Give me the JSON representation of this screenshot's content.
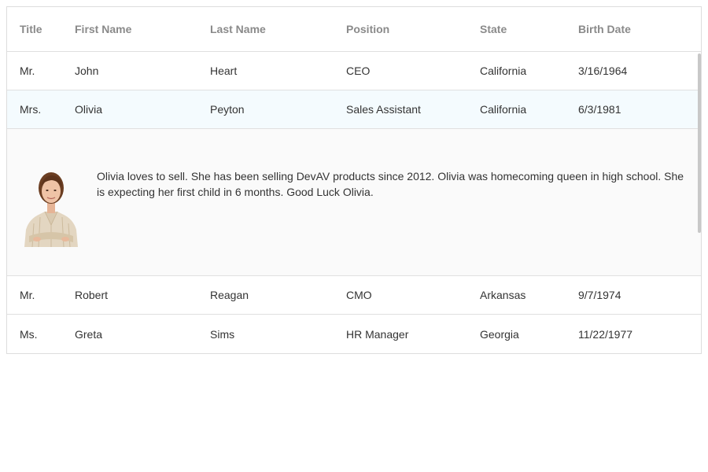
{
  "columns": [
    "Title",
    "First Name",
    "Last Name",
    "Position",
    "State",
    "Birth Date"
  ],
  "rows": [
    {
      "title": "Mr.",
      "first": "John",
      "last": "Heart",
      "position": "CEO",
      "state": "California",
      "birth": "3/16/1964"
    },
    {
      "title": "Mrs.",
      "first": "Olivia",
      "last": "Peyton",
      "position": "Sales Assistant",
      "state": "California",
      "birth": "6/3/1981"
    },
    {
      "title": "Mr.",
      "first": "Robert",
      "last": "Reagan",
      "position": "CMO",
      "state": "Arkansas",
      "birth": "9/7/1974"
    },
    {
      "title": "Ms.",
      "first": "Greta",
      "last": "Sims",
      "position": "HR Manager",
      "state": "Georgia",
      "birth": "11/22/1977"
    }
  ],
  "detail": {
    "text": "Olivia loves to sell. She has been selling DevAV products since 2012. Olivia was homecoming queen in high school. She is expecting her first child in 6 months. Good Luck Olivia.",
    "photo_icon": "employee-photo"
  },
  "colors": {
    "selected_row_bg": "#f4fbfe",
    "detail_bg": "#fafafa",
    "border": "#dddddd",
    "header_text": "#8a8a8a"
  }
}
